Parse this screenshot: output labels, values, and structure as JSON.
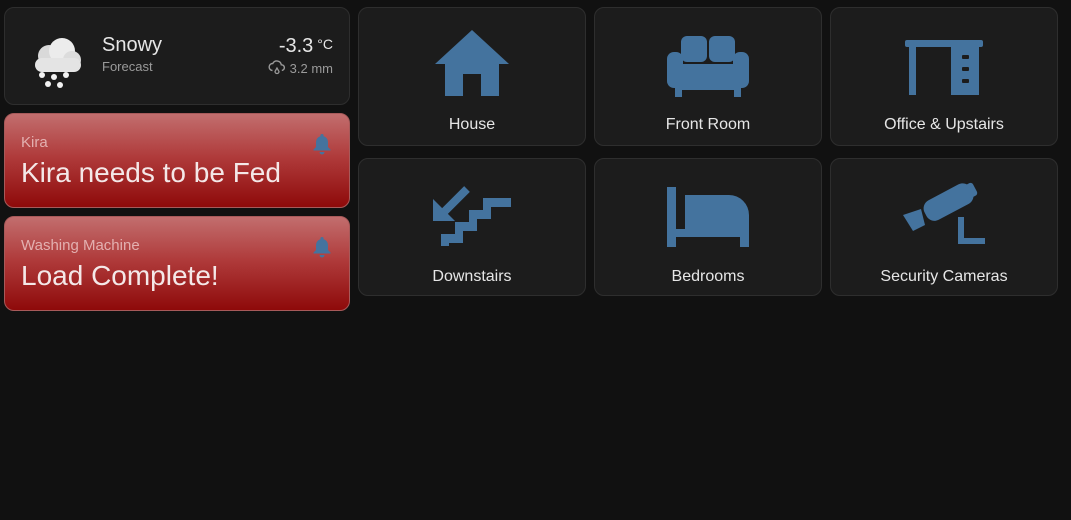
{
  "colors": {
    "background": "#111111",
    "card": "#1c1c1c",
    "icon_blue": "#44739e",
    "alert_red": "#9c1414"
  },
  "weather": {
    "condition": "Snowy",
    "subtitle": "Forecast",
    "temperature": "-3.3",
    "unit": "°C",
    "precipitation": "3.2 mm",
    "icon": "snowy-cloud-icon"
  },
  "alerts": [
    {
      "label": "Kira",
      "message": "Kira needs to be Fed",
      "icon": "bell-icon"
    },
    {
      "label": "Washing Machine",
      "message": "Load Complete!",
      "icon": "bell-icon"
    }
  ],
  "rooms": [
    {
      "label": "House",
      "icon": "house-icon"
    },
    {
      "label": "Front Room",
      "icon": "sofa-icon"
    },
    {
      "label": "Office & Upstairs",
      "icon": "desk-icon"
    },
    {
      "label": "Downstairs",
      "icon": "stairs-down-icon"
    },
    {
      "label": "Bedrooms",
      "icon": "bed-icon"
    },
    {
      "label": "Security Cameras",
      "icon": "cctv-icon"
    }
  ]
}
